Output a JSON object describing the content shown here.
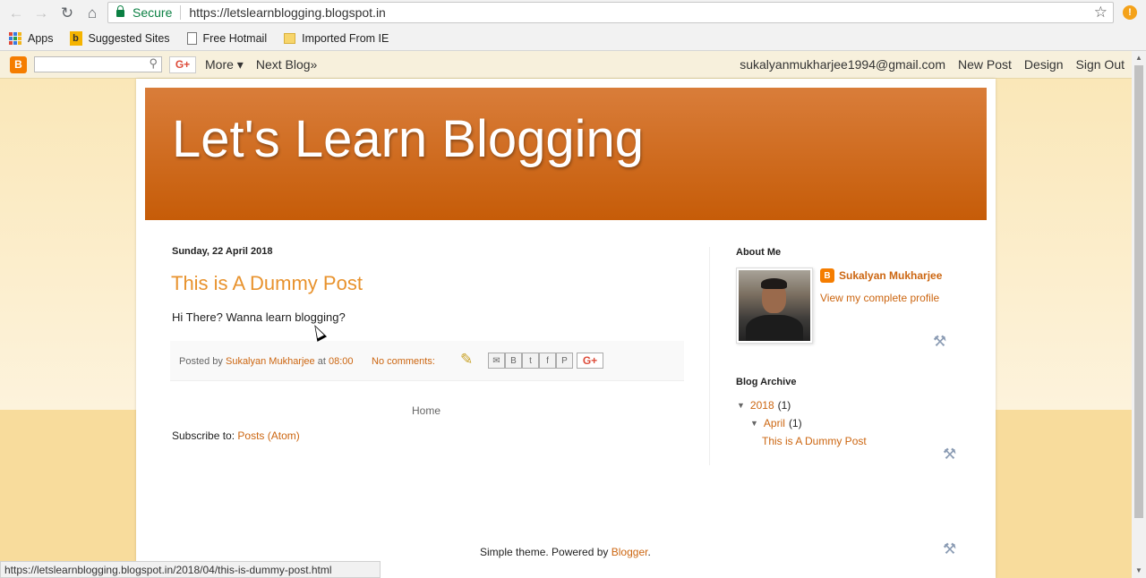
{
  "browser": {
    "secure_label": "Secure",
    "url": "https://letslearnblogging.blogspot.in",
    "alert_icon": "!",
    "bookmarks": [
      "Apps",
      "Suggested Sites",
      "Free Hotmail",
      "Imported From IE"
    ]
  },
  "navbar": {
    "gplus_label": "G+",
    "more_label": "More ▾",
    "next_blog_label": "Next Blog»",
    "email": "sukalyanmukharjee1994@gmail.com",
    "new_post": "New Post",
    "design": "Design",
    "sign_out": "Sign Out"
  },
  "blog": {
    "title": "Let's Learn Blogging"
  },
  "post": {
    "date": "Sunday, 22 April 2018",
    "title": "This is A Dummy Post",
    "body": "Hi There? Wanna learn blogging?",
    "posted_by": "Posted by",
    "author": "Sukalyan Mukharjee",
    "at": "at",
    "time": "08:00",
    "comments": "No comments:",
    "share_gplus": "G+"
  },
  "nav": {
    "home": "Home",
    "subscribe_prefix": "Subscribe to:",
    "subscribe_link": "Posts (Atom)"
  },
  "sidebar": {
    "about_heading": "About Me",
    "profile_name": "Sukalyan Mukharjee",
    "profile_link": "View my complete profile",
    "archive_heading": "Blog Archive",
    "archive": [
      {
        "label": "2018",
        "count": "(1)"
      },
      {
        "label": "April",
        "count": "(1)"
      },
      {
        "label": "This is A Dummy Post"
      }
    ]
  },
  "footer": {
    "powered_prefix": "Simple theme. Powered by",
    "powered_link": "Blogger",
    "powered_suffix": "."
  },
  "status_bar": {
    "url": "https://letslearnblogging.blogspot.in/2018/04/this-is-dummy-post.html"
  },
  "colors": {
    "accent": "#cc6611",
    "header_top": "#d97d3a",
    "header_bottom": "#c65c08",
    "post_title": "#e8922d"
  }
}
